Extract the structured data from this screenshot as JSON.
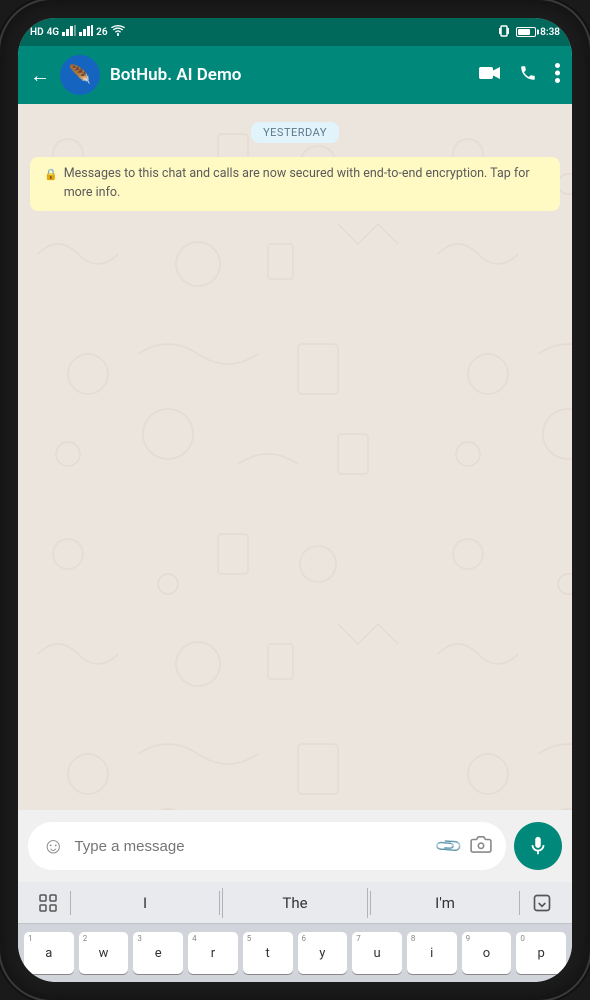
{
  "phone": {
    "status_bar": {
      "left_indicators": "HD 4G 26",
      "time": "8:38",
      "battery_level": 65
    },
    "chat_header": {
      "back_label": "←",
      "contact_name": "BotHub. AI Demo",
      "video_icon": "video-camera",
      "call_icon": "phone",
      "more_icon": "more-vertical"
    },
    "chat": {
      "date_badge": "YESTERDAY",
      "encryption_message": "Messages to this chat and calls are now secured with end-to-end encryption. Tap for more info."
    },
    "input": {
      "placeholder": "Type a message",
      "emoji_icon": "emoji",
      "attach_icon": "paperclip",
      "camera_icon": "camera",
      "voice_icon": "microphone"
    },
    "keyboard": {
      "suggestions": [
        "I",
        "The",
        "I'm"
      ],
      "keys_row": [
        "a",
        "w",
        "e",
        "r",
        "t",
        "y",
        "u",
        "i",
        "o",
        "p"
      ],
      "key_numbers": [
        "1",
        "2",
        "3",
        "4",
        "5",
        "6",
        "7",
        "8",
        "9",
        "0"
      ]
    }
  }
}
